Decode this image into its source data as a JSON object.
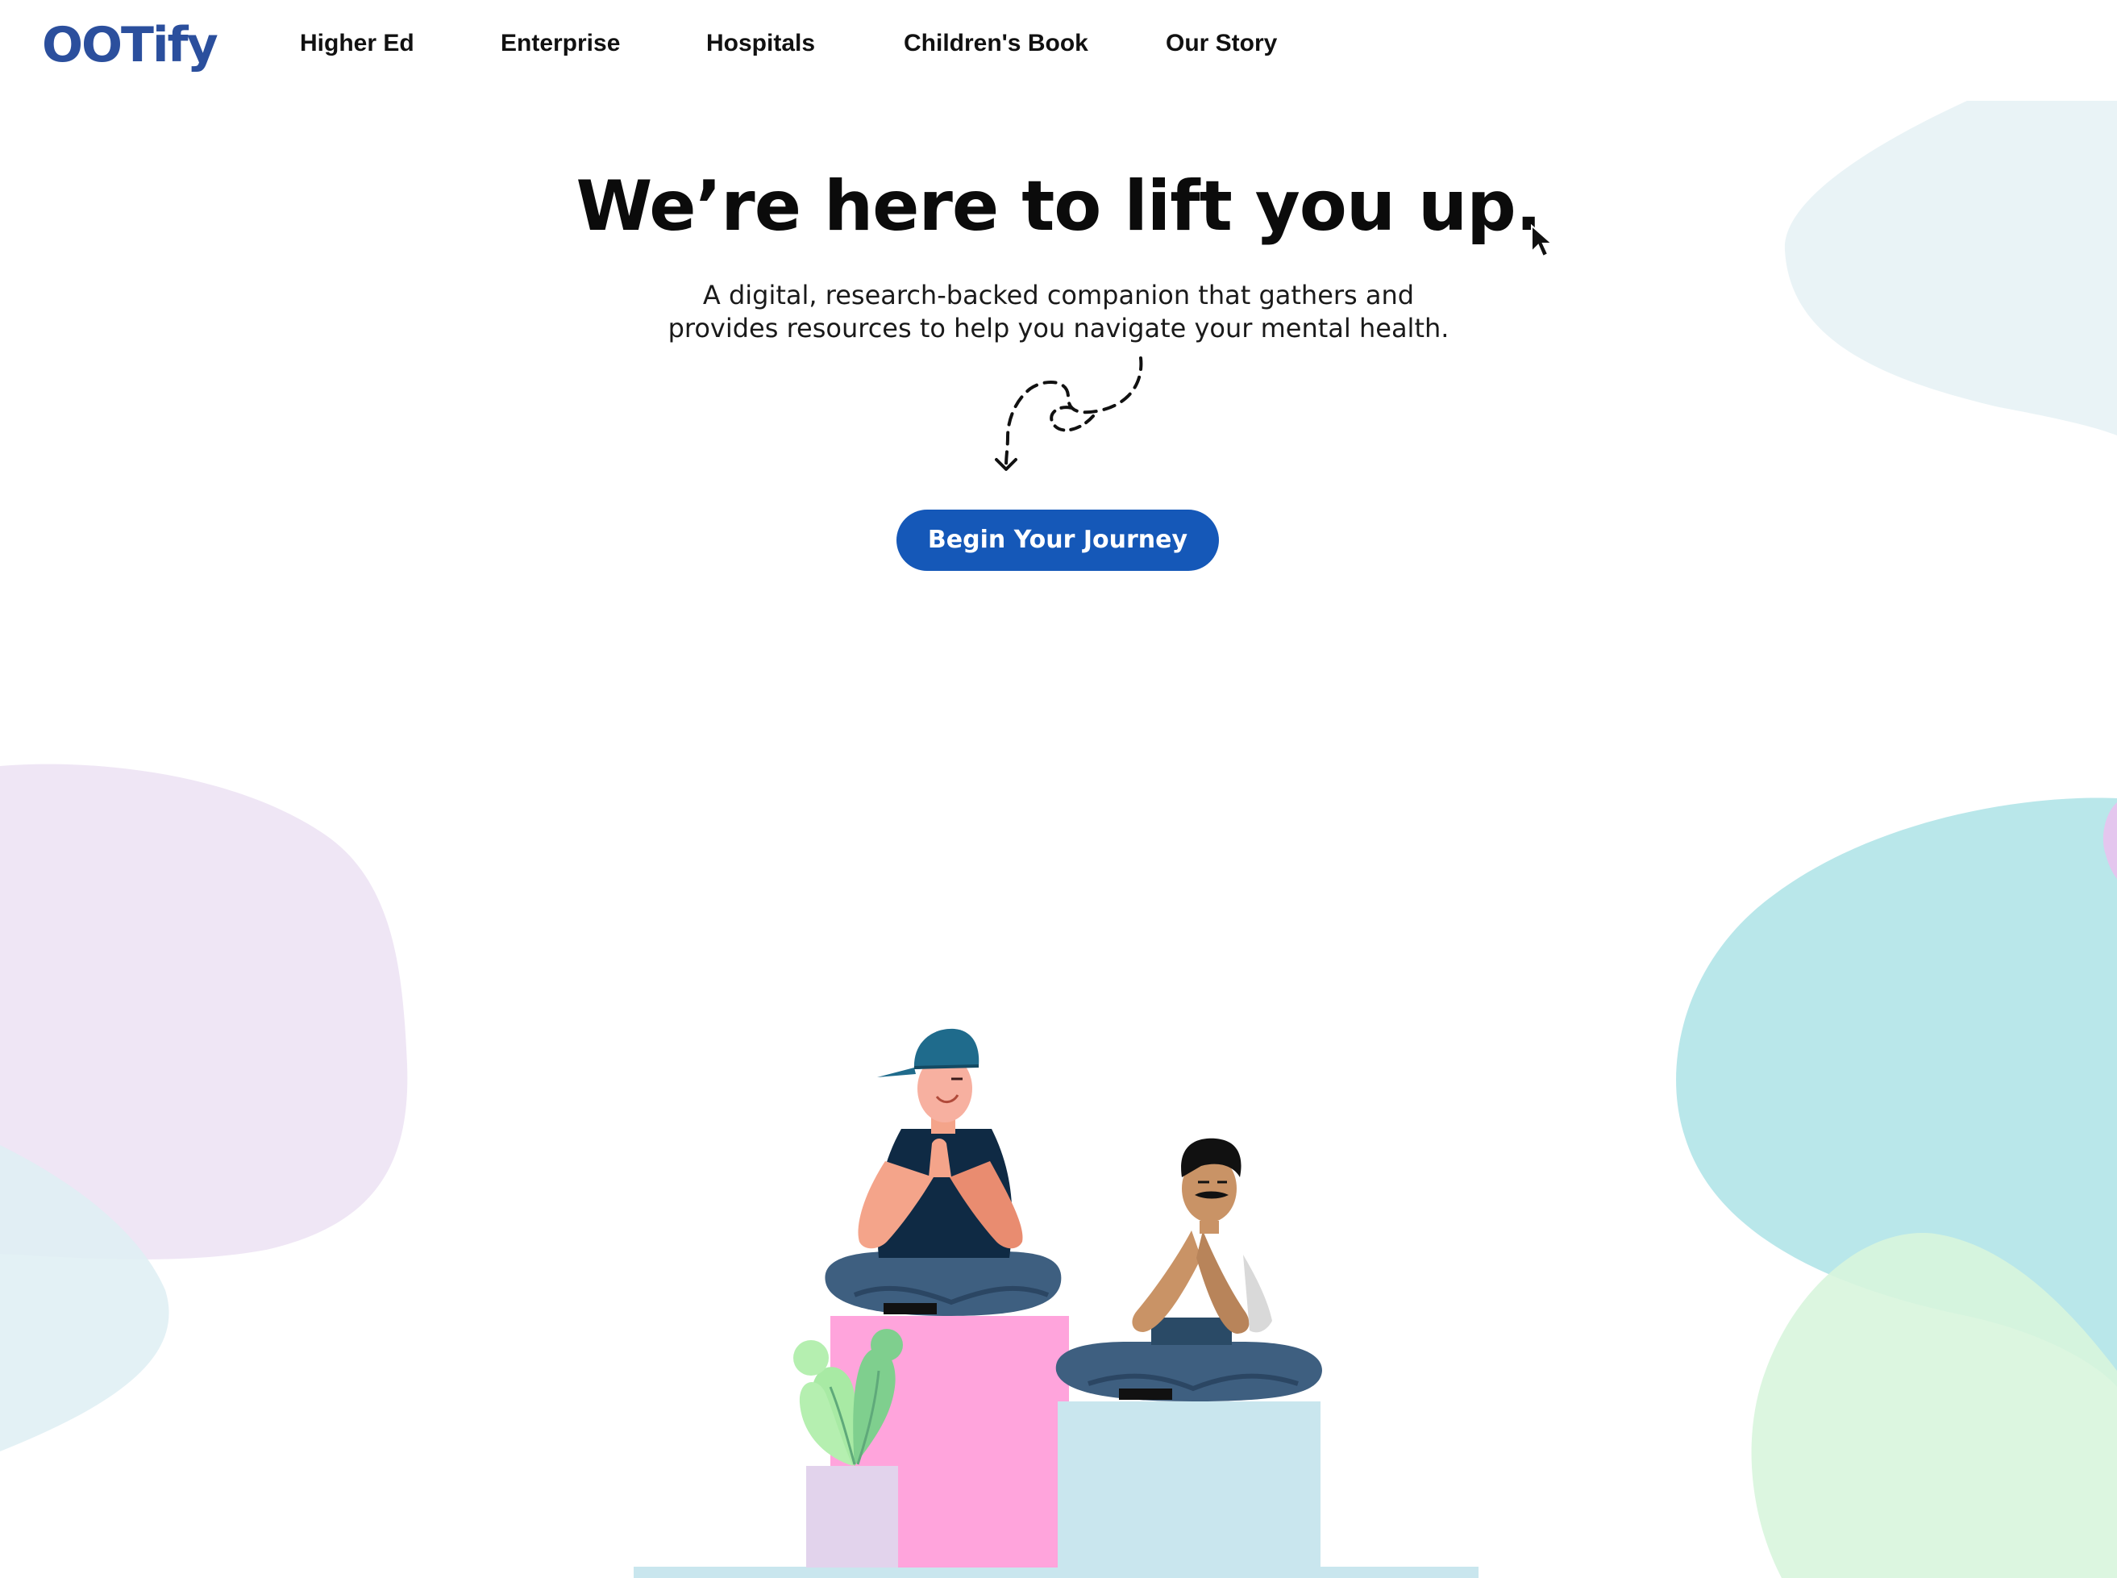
{
  "brand": {
    "logo": "OOTify",
    "primary_color": "#2b4f9d",
    "button_color": "#1558b8"
  },
  "nav": {
    "items": [
      {
        "label": "Higher Ed"
      },
      {
        "label": "Enterprise"
      },
      {
        "label": "Hospitals"
      },
      {
        "label": "Children's Book"
      },
      {
        "label": "Our Story"
      }
    ]
  },
  "hero": {
    "title": "We’re here to lift you up.",
    "subtitle_line1": "A digital, research-backed companion that gathers and",
    "subtitle_line2": "provides resources to help you navigate your mental health.",
    "cta_label": "Begin Your Journey"
  },
  "decor": {
    "arrow_icon": "dashed-loop-arrow-icon",
    "illustration": "meditating-people-illustration",
    "blob_colors": [
      "#e9f3f6",
      "#ece3f4",
      "#b8e6e8",
      "#d6f6dc",
      "#e3f2f6"
    ]
  }
}
